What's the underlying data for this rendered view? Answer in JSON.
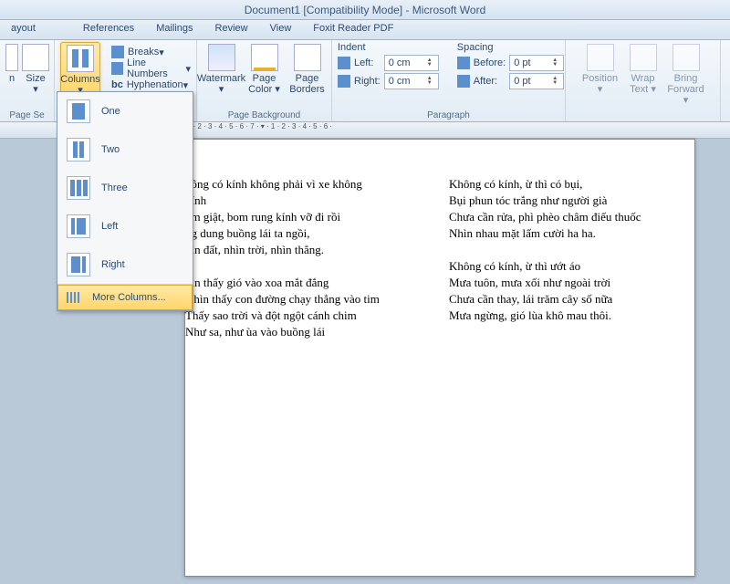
{
  "title": "Document1 [Compatibility Mode] - Microsoft Word",
  "tabs": {
    "layout": "ayout",
    "references": "References",
    "mailings": "Mailings",
    "review": "Review",
    "view": "View",
    "foxit": "Foxit Reader PDF"
  },
  "ribbon": {
    "orientation": "n",
    "size": "Size",
    "columns": "Columns",
    "breaks": "Breaks",
    "linenumbers": "Line Numbers",
    "hyphen": "Hyphenation",
    "pagesetup": "Page Se",
    "watermark": "Watermark",
    "pagecolor": "Page\nColor",
    "pageborders": "Page\nBorders",
    "pagebg": "Page Background",
    "indent_hdr": "Indent",
    "spacing_hdr": "Spacing",
    "left_lbl": "Left:",
    "right_lbl": "Right:",
    "before_lbl": "Before:",
    "after_lbl": "After:",
    "left_val": "0 cm",
    "right_val": "0 cm",
    "before_val": "0 pt",
    "after_val": "0 pt",
    "paragraph": "Paragraph",
    "position": "Position",
    "wrap": "Wrap\nText",
    "bring": "Bring\nForward"
  },
  "dropdown": {
    "one": "One",
    "two": "Two",
    "three": "Three",
    "left": "Left",
    "right": "Right",
    "more": "More Columns..."
  },
  "doc": {
    "col1": {
      "p1l1": "hông có kính không phải vì xe không",
      "p1l2": " kính",
      "p1l3": "om giật, bom rung kính vỡ đi rồi",
      "p1l4": "ng dung buồng lái ta ngồi,",
      "p1l5": "hìn đất, nhìn trời, nhìn thẳng.",
      "p2l1": "hìn thấy gió vào xoa mắt đắng",
      "p2l2": "Nhìn thấy con đường chạy thẳng vào tim",
      "p2l3": "Thấy sao trời và đột ngột cánh chim",
      "p2l4": "Như sa, như ùa vào buồng lái"
    },
    "col2": {
      "p1l1": "Không có kính, ừ thì có bụi,",
      "p1l2": "Bụi phun tóc trắng như người già",
      "p1l3": "Chưa cần rửa, phì phèo châm điếu thuốc",
      "p1l4": "Nhìn nhau mặt lấm cười ha ha.",
      "p2l1": "Không có kính, ừ thì ướt áo",
      "p2l2": "Mưa tuôn, mưa xối như ngoài trời",
      "p2l3": "Chưa cần thay, lái trăm cây số nữa",
      "p2l4": "Mưa ngừng, gió lùa khô mau thôi."
    }
  }
}
